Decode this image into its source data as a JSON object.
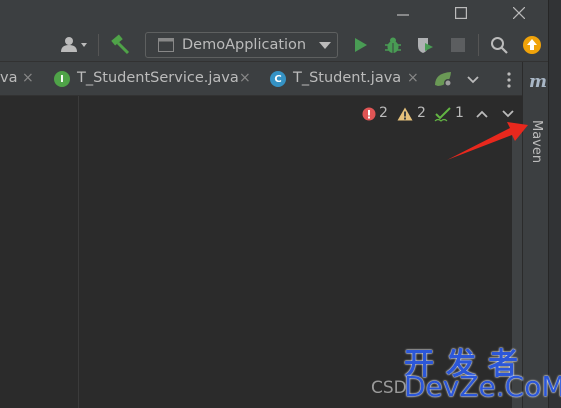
{
  "window": {
    "controls": [
      "minimize",
      "maximize",
      "close"
    ]
  },
  "toolbar": {
    "run_configuration": "DemoApplication",
    "icons": [
      "user-icon",
      "build-hammer-icon",
      "run-icon",
      "debug-icon",
      "coverage-icon",
      "stop-icon",
      "search-icon",
      "update-icon"
    ],
    "colors": {
      "run": "#499c54",
      "update": "#f0a30a",
      "build": "#4fa348"
    }
  },
  "tabs": [
    {
      "label": "va",
      "active": false,
      "close": "×"
    },
    {
      "label": "T_StudentService.java",
      "icon": "I",
      "icon_color": "#4fa348",
      "close": "×"
    },
    {
      "label": "T_Student.java",
      "icon": "C",
      "icon_color": "#3592c4",
      "close": "×"
    }
  ],
  "inspections": {
    "errors": "2",
    "warnings": "2",
    "typos": "1",
    "colors": {
      "error": "#e05555",
      "warning": "#e5c07b",
      "typo": "#62b543"
    }
  },
  "tool_window": {
    "maven_glyph": "m",
    "maven_label": "Maven",
    "annotation_arrow_color": "#e8281d"
  },
  "watermark": {
    "csd": "CSD",
    "cn": "开发者",
    "en": "DevZe.CoM"
  }
}
